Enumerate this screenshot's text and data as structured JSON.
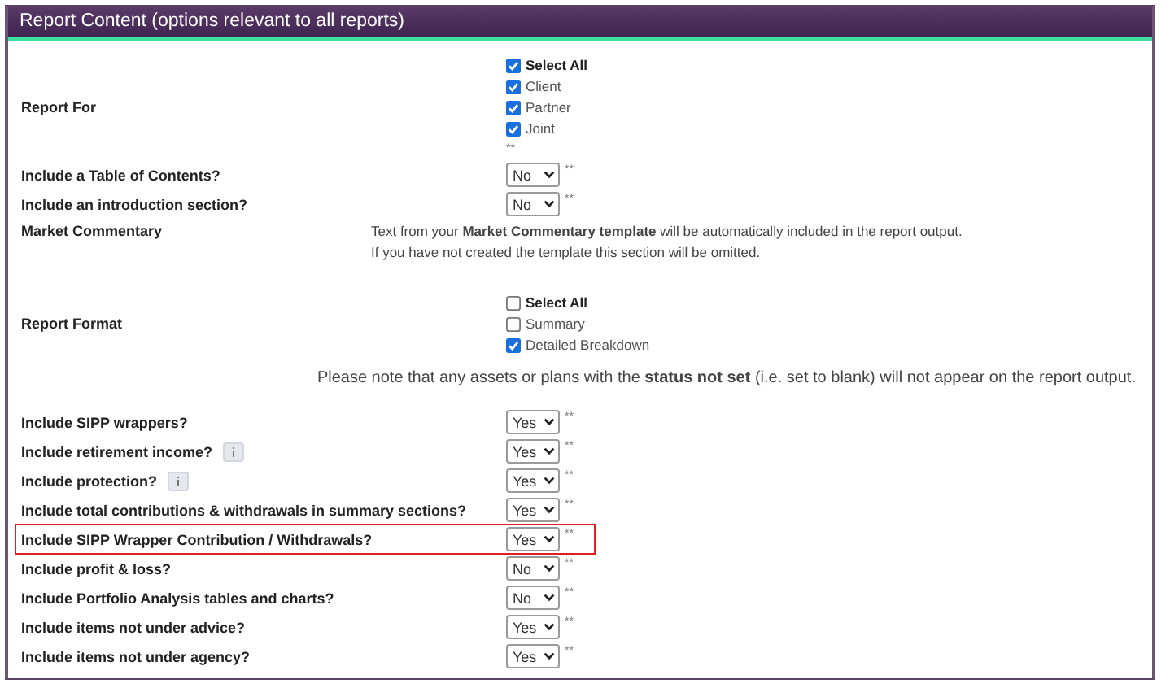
{
  "panel": {
    "title": "Report Content (options relevant to all reports)"
  },
  "rows": [
    {
      "kind": "checkboxes",
      "label": "Report For",
      "options": [
        {
          "label": "Select All",
          "checked": true,
          "bold": true
        },
        {
          "label": "Client",
          "checked": true,
          "bold": false
        },
        {
          "label": "Partner",
          "checked": true,
          "bold": false
        },
        {
          "label": "Joint",
          "checked": true,
          "bold": false
        }
      ],
      "note": "**"
    },
    {
      "kind": "select",
      "label": "Include a Table of Contents?",
      "value": "No",
      "note": "**",
      "info": false,
      "highlighted": false
    },
    {
      "kind": "select",
      "label": "Include an introduction section?",
      "value": "No",
      "note": "**",
      "info": false,
      "highlighted": false
    },
    {
      "kind": "text",
      "label": "Market Commentary",
      "lines": [
        "Text from your **Market Commentary template** will be automatically included in the report output.",
        "If you have not created the template this section will be omitted."
      ]
    },
    {
      "kind": "checkboxes",
      "label": "Report Format",
      "options": [
        {
          "label": "Select All",
          "checked": false,
          "bold": true
        },
        {
          "label": "Summary",
          "checked": false,
          "bold": false
        },
        {
          "label": "Detailed Breakdown",
          "checked": true,
          "bold": false
        }
      ]
    },
    {
      "kind": "notice",
      "text": "Please note that any assets or plans with the **status not set** (i.e. set to blank) will not appear on the report output."
    },
    {
      "kind": "select",
      "label": "Include SIPP wrappers?",
      "value": "Yes",
      "note": "**",
      "info": false,
      "highlighted": false
    },
    {
      "kind": "select",
      "label": "Include retirement income?",
      "value": "Yes",
      "note": "**",
      "info": true,
      "highlighted": false
    },
    {
      "kind": "select",
      "label": "Include protection?",
      "value": "Yes",
      "note": "**",
      "info": true,
      "highlighted": false
    },
    {
      "kind": "select",
      "label": "Include total contributions & withdrawals in summary sections?",
      "value": "Yes",
      "note": "**",
      "info": false,
      "highlighted": false
    },
    {
      "kind": "select",
      "label": "Include SIPP Wrapper Contribution / Withdrawals?",
      "value": "Yes",
      "note": "**",
      "info": false,
      "highlighted": true
    },
    {
      "kind": "select",
      "label": "Include profit & loss?",
      "value": "No",
      "note": "**",
      "info": false,
      "highlighted": false
    },
    {
      "kind": "select",
      "label": "Include Portfolio Analysis tables and charts?",
      "value": "No",
      "note": "**",
      "info": false,
      "highlighted": false
    },
    {
      "kind": "select",
      "label": "Include items not under advice?",
      "value": "Yes",
      "note": "**",
      "info": false,
      "highlighted": false
    },
    {
      "kind": "select",
      "label": "Include items not under agency?",
      "value": "Yes",
      "note": "**",
      "info": false,
      "highlighted": false
    }
  ]
}
